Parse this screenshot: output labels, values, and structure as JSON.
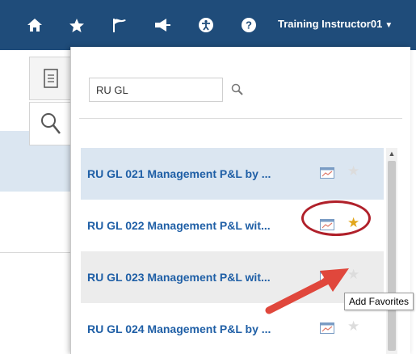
{
  "header": {
    "icons": [
      "home-icon",
      "star-icon",
      "flag-icon",
      "alerts-icon",
      "accessibility-icon",
      "help-icon"
    ],
    "user_label": "Training Instructor01"
  },
  "side_tabs": [
    "document-icon",
    "search-icon"
  ],
  "search": {
    "value": "RU GL"
  },
  "results": [
    {
      "label": "RU GL 021 Management P&L by ...",
      "favorite": false,
      "highlighted": true
    },
    {
      "label": "RU GL 022 Management P&L wit...",
      "favorite": true,
      "highlighted": false
    },
    {
      "label": "RU GL 023 Management P&L wit...",
      "favorite": false,
      "highlighted": false
    },
    {
      "label": "RU GL 024 Management P&L by ...",
      "favorite": false,
      "highlighted": false
    }
  ],
  "tooltip": "Add Favorites",
  "colors": {
    "header": "#1f4c7a",
    "link": "#1f5fa6",
    "favorite_on": "#e2a61c",
    "callout": "#b0202a",
    "arrow": "#e0473c"
  }
}
